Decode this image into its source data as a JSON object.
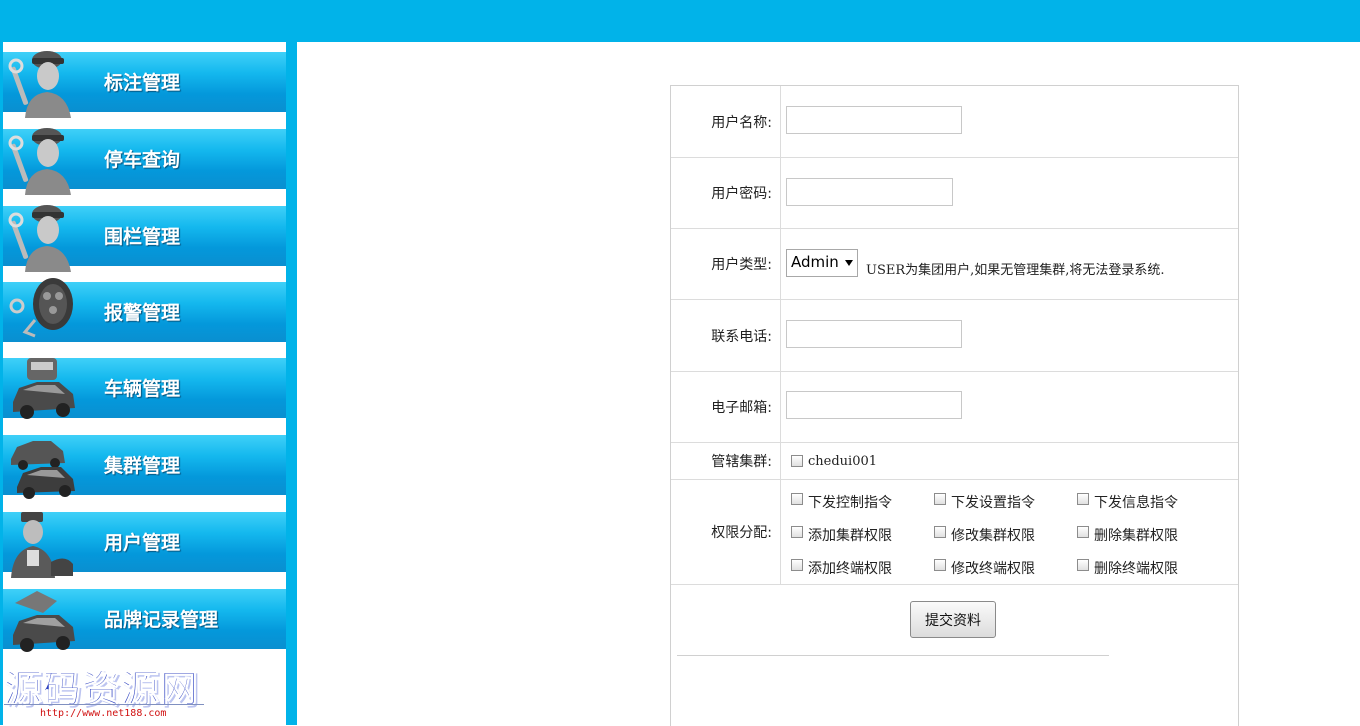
{
  "sidebar": {
    "items": [
      {
        "label": "标注管理",
        "icon": "mechanic-icon"
      },
      {
        "label": "停车查询",
        "icon": "mechanic-icon"
      },
      {
        "label": "围栏管理",
        "icon": "mechanic-icon"
      },
      {
        "label": "报警管理",
        "icon": "car-key-icon"
      },
      {
        "label": "车辆管理",
        "icon": "car-icon"
      },
      {
        "label": "集群管理",
        "icon": "cars-icon"
      },
      {
        "label": "用户管理",
        "icon": "user-icon"
      },
      {
        "label": "品牌记录管理",
        "icon": "car-service-icon"
      }
    ]
  },
  "watermark": {
    "title": "源码资源网",
    "url": "http://www.net188.com"
  },
  "form": {
    "username_label": "用户名称:",
    "username_value": "",
    "password_label": "用户密码:",
    "password_value": "",
    "type_label": "用户类型:",
    "type_selected": "Admin",
    "type_hint": "USER为集团用户,如果无管理集群,将无法登录系统.",
    "phone_label": "联系电话:",
    "phone_value": "",
    "email_label": "电子邮箱:",
    "email_value": "",
    "cluster_label": "管辖集群:",
    "clusters": [
      "chedui001"
    ],
    "perm_label": "权限分配:",
    "permissions": [
      "下发控制指令",
      "下发设置指令",
      "下发信息指令",
      "添加集群权限",
      "修改集群权限",
      "删除集群权限",
      "添加终端权限",
      "修改终端权限",
      "删除终端权限"
    ],
    "submit_label": "提交资料"
  },
  "colors": {
    "accent": "#01b3e9",
    "nav_top": "#3fd0f8",
    "nav_bottom": "#0a8fd0"
  }
}
